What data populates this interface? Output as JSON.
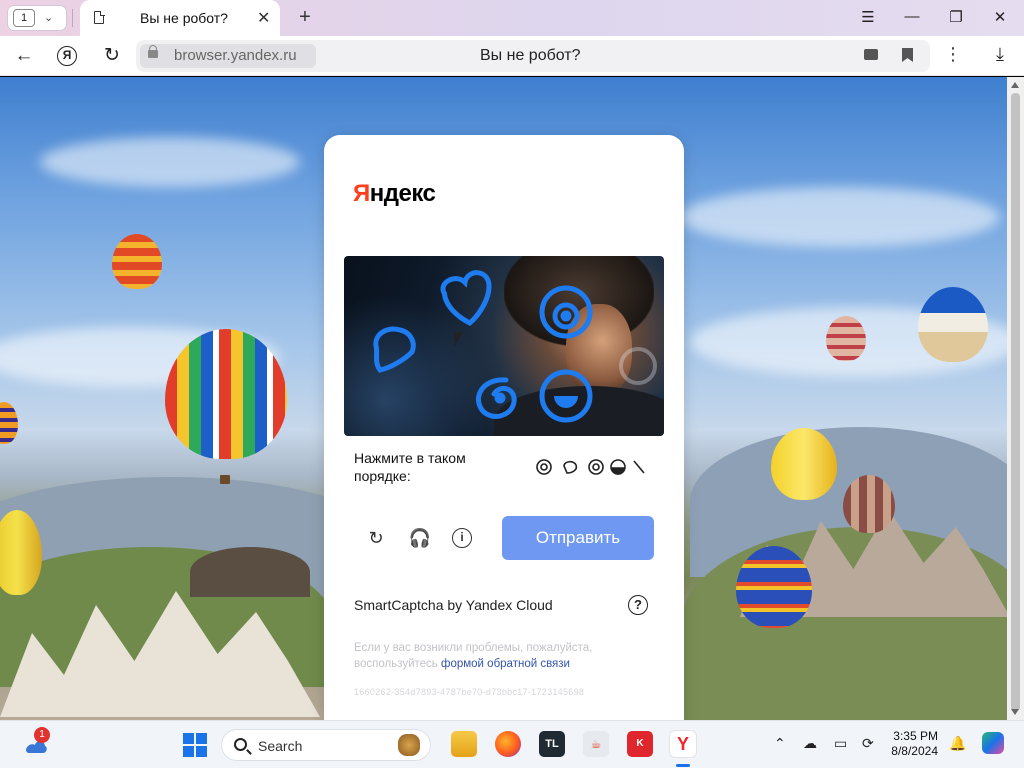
{
  "browser": {
    "tab_count": "1",
    "tab_title": "Вы не робот?",
    "url_host": "browser.yandex.ru",
    "page_title": "Вы не робот?",
    "yandex_button": "Я",
    "new_tab": "+",
    "tab_close": "✕",
    "menu": "⋮",
    "window_controls": {
      "tabs_menu": "☰",
      "minimize": "—",
      "restore": "❐",
      "close": "✕"
    }
  },
  "captcha": {
    "logo_first": "Я",
    "logo_rest": "ндекс",
    "prompt": "Нажмите в таком порядке:",
    "submit_label": "Отправить",
    "brand": "SmartCaptcha by Yandex Cloud",
    "help": "?",
    "note_text": "Если у вас возникли проблемы, пожалуйста, воспользуйтесь ",
    "note_link": "формой обратной связи",
    "request_id": "1660262-354d7893-4787be70-d73bbc17-1723145698",
    "icons": [
      "refresh-icon",
      "headphones-icon",
      "info-icon"
    ]
  },
  "taskbar": {
    "weather_badge": "1",
    "search_label": "Search",
    "apps": [
      "file-explorer",
      "firefox",
      "tl-app",
      "java",
      "kaspersky",
      "yandex-browser"
    ],
    "time": "3:35 PM",
    "date": "8/8/2024",
    "tray_icons": [
      "chevron-up-icon",
      "network-icon",
      "display-icon",
      "sync-icon",
      "bell-icon",
      "copilot-icon"
    ]
  },
  "colors": {
    "submit": "#6e98f1",
    "accent_blue": "#1a73e8",
    "yandex_red": "#fc3f1d",
    "captcha_icon": "#1e7cf0"
  }
}
